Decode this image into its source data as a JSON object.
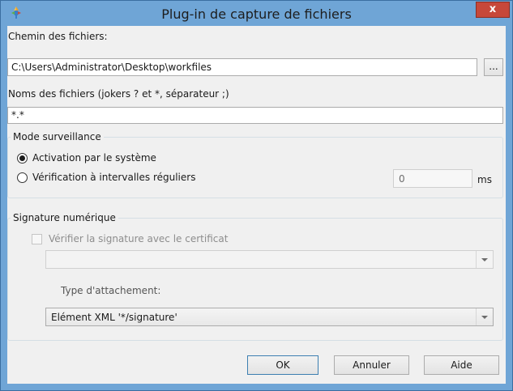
{
  "window": {
    "title": "Plug-in de capture de fichiers",
    "close_glyph": "x"
  },
  "file_path": {
    "label": "Chemin des fichiers:",
    "value": "C:\\Users\\Administrator\\Desktop\\workfiles",
    "browse_label": "..."
  },
  "file_names": {
    "label": "Noms des fichiers (jokers ? et *, séparateur ;)",
    "value": "*.*"
  },
  "monitoring": {
    "title": "Mode surveillance",
    "option_system": "Activation par le système",
    "option_interval": "Vérification à intervalles réguliers",
    "selected": "option_system",
    "interval_value": "0",
    "interval_unit": "ms"
  },
  "signature": {
    "title": "Signature numérique",
    "verify_label": "Vérifier la signature avec le certificat",
    "verify_checked": false,
    "certificate_value": "",
    "attachment_label": "Type d'attachement:",
    "attachment_value": "Elément XML '*/signature'"
  },
  "buttons": {
    "ok": "OK",
    "cancel": "Annuler",
    "help": "Aide"
  },
  "colors": {
    "titlebar": "#6fa5d6",
    "close": "#c7483a",
    "dialog_bg": "#f0f0f0"
  }
}
